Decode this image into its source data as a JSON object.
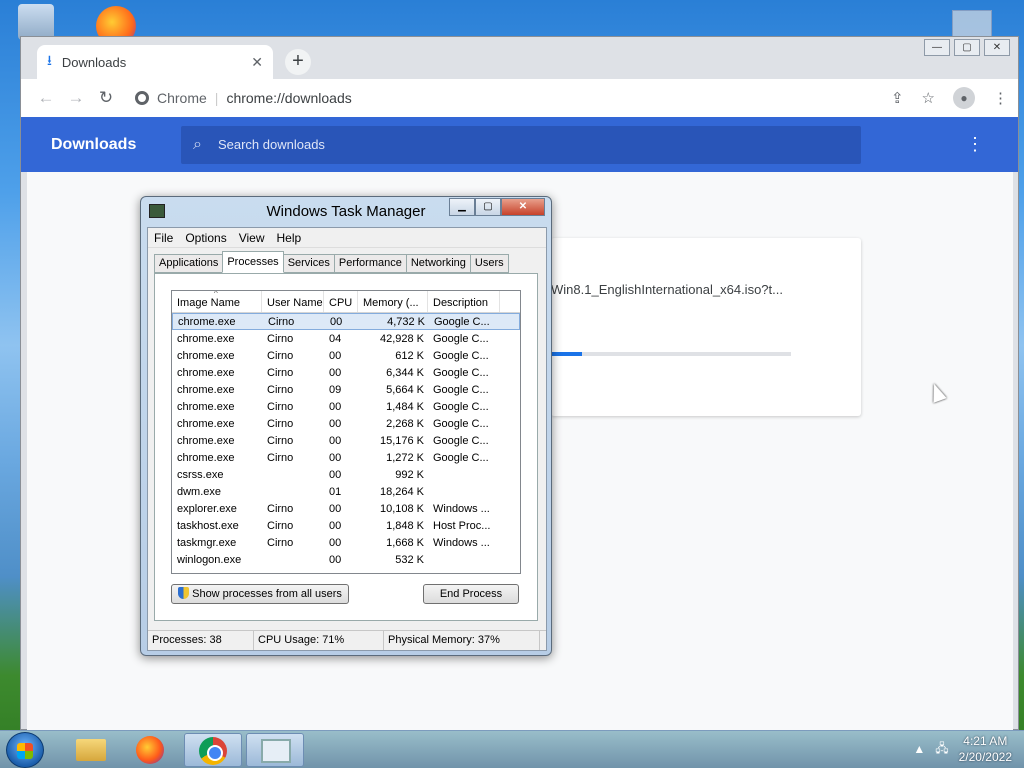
{
  "chrome": {
    "tab_title": "Downloads",
    "toolbar": {
      "site_label": "Chrome",
      "url": "chrome://downloads"
    },
    "downloads_page": {
      "title": "Downloads",
      "search_placeholder": "Search downloads",
      "item": {
        "file_name": "Win8.1_EnglishInternational_x64.iso?t...",
        "progress": 0.13
      }
    }
  },
  "task_manager": {
    "title": "Windows Task Manager",
    "menu": [
      "File",
      "Options",
      "View",
      "Help"
    ],
    "tabs": [
      "Applications",
      "Processes",
      "Services",
      "Performance",
      "Networking",
      "Users"
    ],
    "active_tab": "Processes",
    "columns": [
      "Image Name",
      "User Name",
      "CPU",
      "Memory (...",
      "Description"
    ],
    "rows": [
      {
        "image": "chrome.exe",
        "user": "Cirno",
        "cpu": "00",
        "mem": "4,732 K",
        "desc": "Google C..."
      },
      {
        "image": "chrome.exe",
        "user": "Cirno",
        "cpu": "04",
        "mem": "42,928 K",
        "desc": "Google C..."
      },
      {
        "image": "chrome.exe",
        "user": "Cirno",
        "cpu": "00",
        "mem": "612 K",
        "desc": "Google C..."
      },
      {
        "image": "chrome.exe",
        "user": "Cirno",
        "cpu": "00",
        "mem": "6,344 K",
        "desc": "Google C..."
      },
      {
        "image": "chrome.exe",
        "user": "Cirno",
        "cpu": "09",
        "mem": "5,664 K",
        "desc": "Google C..."
      },
      {
        "image": "chrome.exe",
        "user": "Cirno",
        "cpu": "00",
        "mem": "1,484 K",
        "desc": "Google C..."
      },
      {
        "image": "chrome.exe",
        "user": "Cirno",
        "cpu": "00",
        "mem": "2,268 K",
        "desc": "Google C..."
      },
      {
        "image": "chrome.exe",
        "user": "Cirno",
        "cpu": "00",
        "mem": "15,176 K",
        "desc": "Google C..."
      },
      {
        "image": "chrome.exe",
        "user": "Cirno",
        "cpu": "00",
        "mem": "1,272 K",
        "desc": "Google C..."
      },
      {
        "image": "csrss.exe",
        "user": "",
        "cpu": "00",
        "mem": "992 K",
        "desc": ""
      },
      {
        "image": "dwm.exe",
        "user": "",
        "cpu": "01",
        "mem": "18,264 K",
        "desc": ""
      },
      {
        "image": "explorer.exe",
        "user": "Cirno",
        "cpu": "00",
        "mem": "10,108 K",
        "desc": "Windows ..."
      },
      {
        "image": "taskhost.exe",
        "user": "Cirno",
        "cpu": "00",
        "mem": "1,848 K",
        "desc": "Host Proc..."
      },
      {
        "image": "taskmgr.exe",
        "user": "Cirno",
        "cpu": "00",
        "mem": "1,668 K",
        "desc": "Windows ..."
      },
      {
        "image": "winlogon.exe",
        "user": "",
        "cpu": "00",
        "mem": "532 K",
        "desc": ""
      }
    ],
    "show_all_button": "Show processes from all users",
    "end_process_button": "End Process",
    "status": {
      "processes": "Processes: 38",
      "cpu": "CPU Usage: 71%",
      "memory": "Physical Memory: 37%"
    }
  },
  "taskbar": {
    "time": "4:21 AM",
    "date": "2/20/2022"
  }
}
